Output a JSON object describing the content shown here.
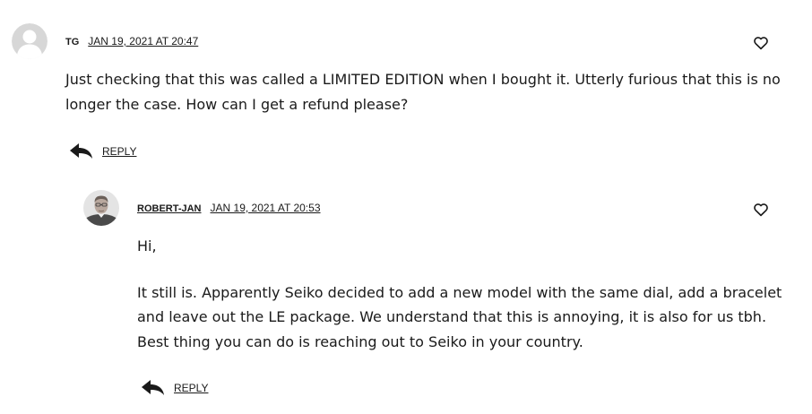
{
  "comments": [
    {
      "author": "TG",
      "date": "JAN 19, 2021 AT 20:47",
      "text": "Just checking that this was called a LIMITED EDITION when I bought it. Utterly furious that this is no longer the case. How can I get a refund please?",
      "reply_label": "REPLY",
      "avatar": "default-avatar-icon"
    },
    {
      "author": "ROBERT-JAN",
      "date": "JAN 19, 2021 AT 20:53",
      "paragraphs": [
        "Hi,",
        "It still is. Apparently Seiko decided to add a new model with the same dial, add a bracelet and leave out the LE package. We understand that this is annoying, it is also for us tbh. Best thing you can do is reaching out to Seiko in your country."
      ],
      "reply_label": "REPLY",
      "avatar": "author-photo"
    }
  ],
  "icons": {
    "like": "heart-icon",
    "reply": "reply-arrow-icon"
  }
}
